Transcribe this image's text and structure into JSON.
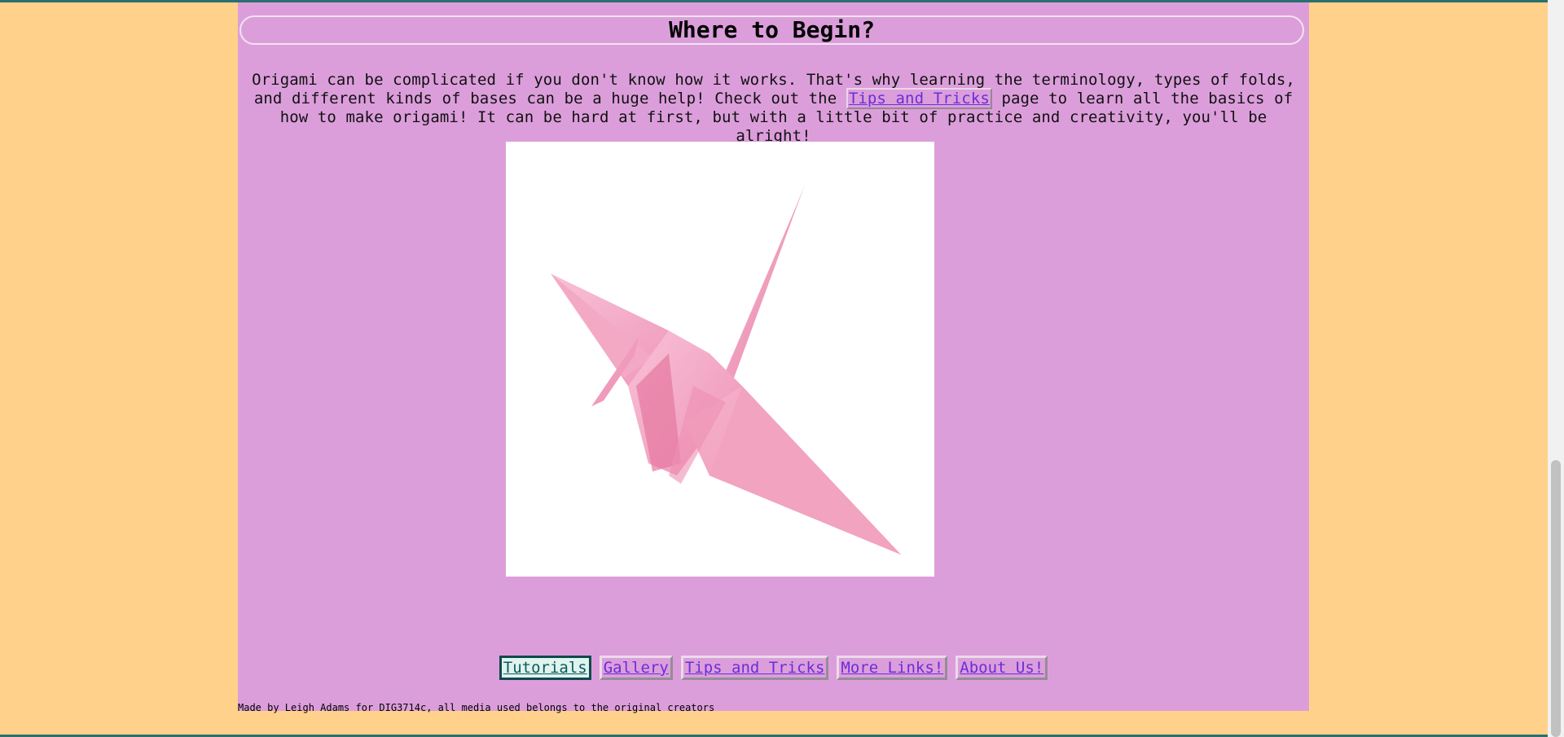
{
  "header": {
    "title": "Where to Begin?"
  },
  "intro": {
    "text_before_link": "Origami can be complicated if you don't know how it works. That's why learning the terminology, types of folds, and different kinds of bases can be a huge help! Check out the ",
    "link_label": "Tips and Tricks",
    "text_after_link": " page to learn all the basics of how to make origami! It can be hard at first, but with a little bit of practice and creativity, you'll be alright!"
  },
  "image": {
    "subject": "pink origami crane"
  },
  "nav": {
    "items": [
      {
        "label": "Tutorials"
      },
      {
        "label": "Gallery"
      },
      {
        "label": "Tips and Tricks"
      },
      {
        "label": "More Links!"
      },
      {
        "label": "About Us!"
      }
    ]
  },
  "footer": {
    "text": "Made by Leigh Adams for DIG3714c, all media used belongs to the original creators"
  },
  "colors": {
    "page_background": "#ffd18a",
    "content_background": "#dc9edb",
    "link": "#6a2ed8",
    "crane": "#f4a7c3"
  }
}
